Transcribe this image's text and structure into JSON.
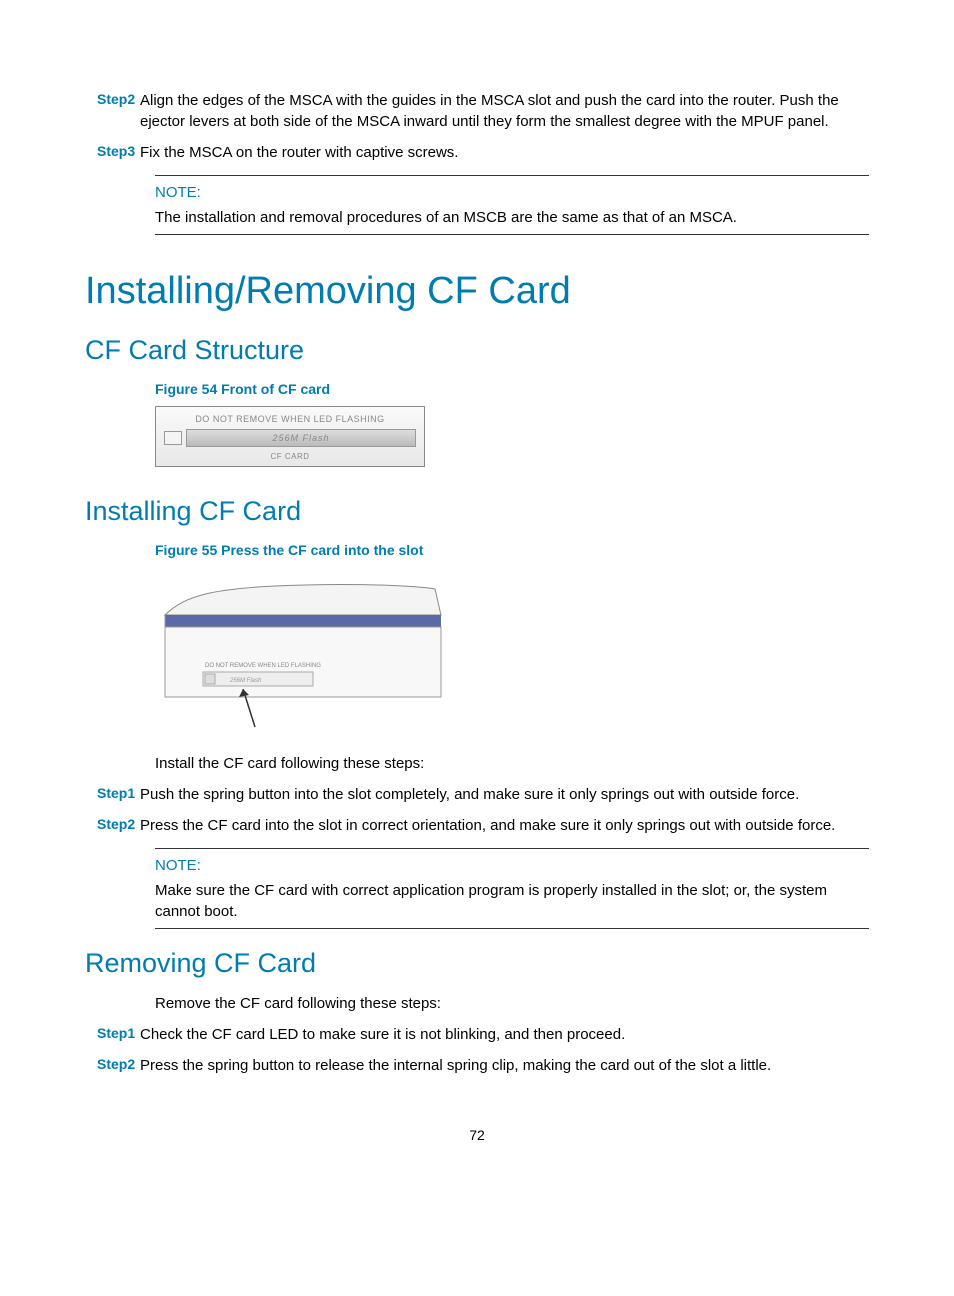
{
  "topSteps": [
    {
      "label": "Step2",
      "text": "Align the edges of the MSCA with the guides in the MSCA slot and push the card into the router. Push the ejector levers at both side of the MSCA inward until they form the smallest degree with the MPUF panel."
    },
    {
      "label": "Step3",
      "text": "Fix the MSCA on the router with captive screws."
    }
  ],
  "note1": {
    "label": "NOTE:",
    "text": "The installation and removal procedures of an MSCB are the same as that of an MSCA."
  },
  "h1": "Installing/Removing CF Card",
  "h2a": "CF Card Structure",
  "fig54": {
    "caption": "Figure 54 Front of CF card",
    "top": "DO NOT REMOVE WHEN LED FLASHING",
    "mid": "256M Flash",
    "bot": "CF CARD"
  },
  "h2b": "Installing CF Card",
  "fig55": {
    "caption": "Figure 55 Press the CF card into the slot",
    "label1": "DO NOT REMOVE WHEN LED FLASHING",
    "label2": "256M Flash"
  },
  "installIntro": "Install the CF card following these steps:",
  "installSteps": [
    {
      "label": "Step1",
      "text": "Push the spring button into the slot completely, and make sure it only springs out with outside force."
    },
    {
      "label": "Step2",
      "text": "Press the CF card into the slot in correct orientation, and make sure it only springs out with outside force."
    }
  ],
  "note2": {
    "label": "NOTE:",
    "text": "Make sure the CF card with correct application program is properly installed in the slot; or, the system cannot boot."
  },
  "h2c": "Removing CF Card",
  "removeIntro": "Remove the CF card following these steps:",
  "removeSteps": [
    {
      "label": "Step1",
      "text": "Check the CF card LED to make sure it is not blinking, and then proceed."
    },
    {
      "label": "Step2",
      "text": "Press the spring button to release the internal spring clip, making the card out of the slot a little."
    }
  ],
  "pageNo": "72"
}
